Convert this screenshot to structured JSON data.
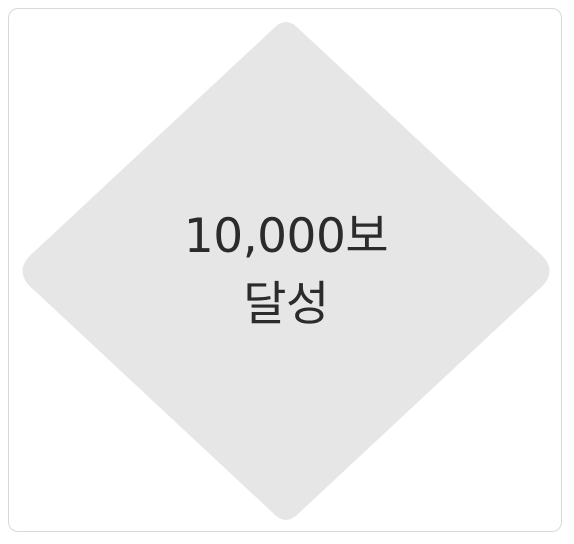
{
  "badge": {
    "line1": "10,000보",
    "line2": "달성",
    "fill_color": "#e6e6e6",
    "text_color": "#2b2b2b"
  }
}
